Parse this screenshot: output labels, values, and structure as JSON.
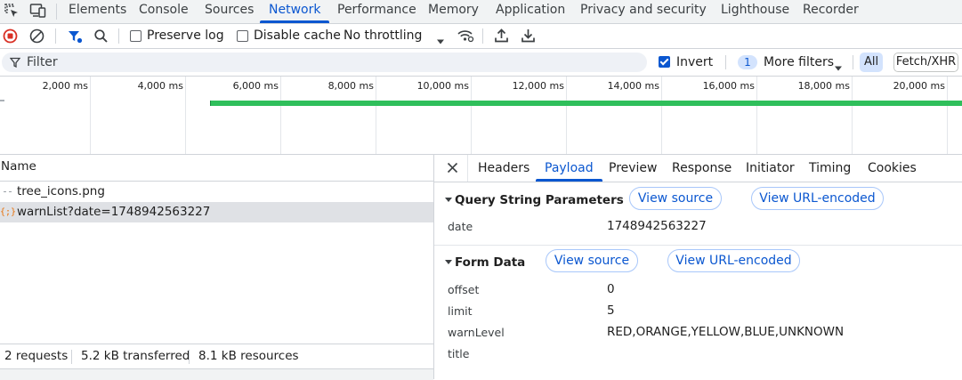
{
  "tabs": [
    "Elements",
    "Console",
    "Sources",
    "Network",
    "Performance",
    "Memory",
    "Application",
    "Privacy and security",
    "Lighthouse",
    "Recorder"
  ],
  "toolbar": {
    "preserve_log": "Preserve log",
    "disable_cache": "Disable cache",
    "throttling": "No throttling"
  },
  "filter": {
    "placeholder": "Filter",
    "invert": "Invert",
    "more_filters_count": "1",
    "more_filters": "More filters",
    "all": "All",
    "fetch_xhr": "Fetch/XHR"
  },
  "timeline": {
    "ticks": [
      "2,000 ms",
      "4,000 ms",
      "6,000 ms",
      "8,000 ms",
      "10,000 ms",
      "12,000 ms",
      "14,000 ms",
      "16,000 ms",
      "18,000 ms",
      "20,000 ms"
    ],
    "bar_color": "#2fbf5b"
  },
  "requests": {
    "name_header": "Name",
    "rows": [
      {
        "name": "tree_icons.png"
      },
      {
        "name": "warnList?date=1748942563227"
      }
    ],
    "status": {
      "requests": "2 requests",
      "transferred": "5.2 kB transferred",
      "resources": "8.1 kB resources"
    }
  },
  "details": {
    "tabs": [
      "Headers",
      "Payload",
      "Preview",
      "Response",
      "Initiator",
      "Timing",
      "Cookies"
    ],
    "active_tab": "Payload",
    "query": {
      "title": "Query String Parameters",
      "view_source": "View source",
      "view_url_encoded": "View URL-encoded",
      "params": [
        {
          "key": "date",
          "value": "1748942563227"
        }
      ]
    },
    "form": {
      "title": "Form Data",
      "view_source": "View source",
      "view_url_encoded": "View URL-encoded",
      "params": [
        {
          "key": "offset",
          "value": "0"
        },
        {
          "key": "limit",
          "value": "5"
        },
        {
          "key": "warnLevel",
          "value": "RED,ORANGE,YELLOW,BLUE,UNKNOWN"
        },
        {
          "key": "title",
          "value": ""
        }
      ]
    }
  },
  "colors": {
    "accent": "#0b57d0",
    "record": "#d93025"
  }
}
